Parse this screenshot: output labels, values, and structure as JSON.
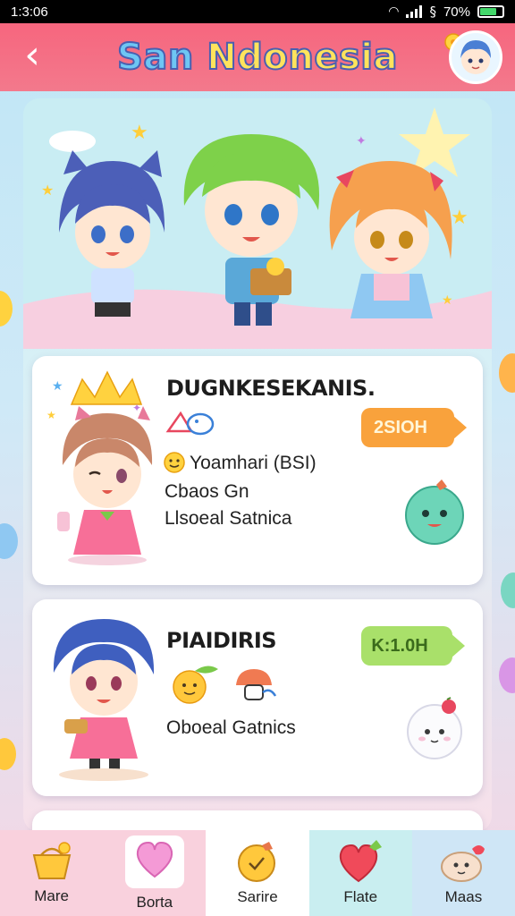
{
  "status_bar": {
    "time": "1:3:06",
    "battery": "70%"
  },
  "header": {
    "title_part1": "San",
    "title_part2": "Ndonesia"
  },
  "cards": [
    {
      "title": "DUGNKESEKANIS.",
      "line1": "Yoamhari (BSI)",
      "line2": "Cbaos Gn",
      "line3": "Llsoeal Satnica",
      "price": "2SIOH",
      "price_color": "#f9a23c"
    },
    {
      "title": "PIAIDIRIS",
      "line1": "Oboeal Gatnics",
      "price": "K:1.0H",
      "price_color": "#a9e06a"
    }
  ],
  "bottom_nav": [
    {
      "label": "Mare",
      "icon": "basket-icon"
    },
    {
      "label": "Borta",
      "icon": "heart-icon"
    },
    {
      "label": "Sarire",
      "icon": "fruit-icon"
    },
    {
      "label": "Flate",
      "icon": "strawberry-icon"
    },
    {
      "label": "Maas",
      "icon": "bun-icon"
    }
  ],
  "colors": {
    "header": "#f6667e",
    "title_yellow": "#ffe35c",
    "title_blue": "#6ec6f4"
  }
}
